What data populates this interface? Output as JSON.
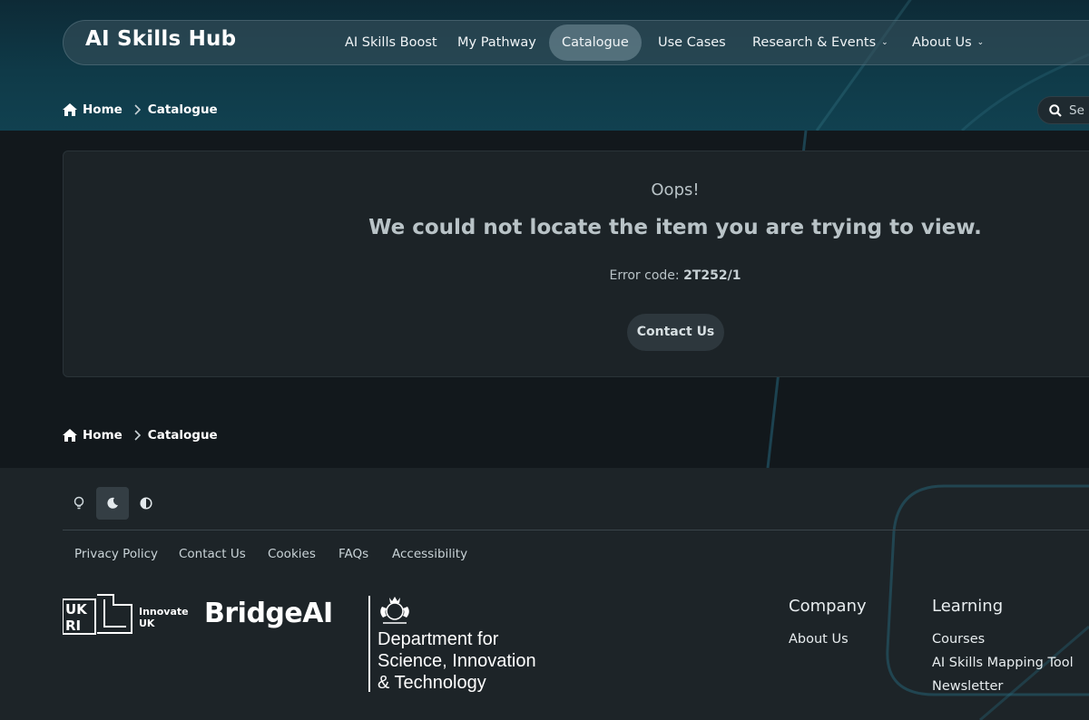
{
  "header": {
    "brand": "AI Skills Hub",
    "nav": [
      {
        "label": "AI Skills Boost"
      },
      {
        "label": "My Pathway"
      },
      {
        "label": "Catalogue"
      },
      {
        "label": "Use Cases"
      },
      {
        "label": "Research & Events"
      },
      {
        "label": "About Us"
      }
    ],
    "search_placeholder": "Se"
  },
  "breadcrumb": {
    "home": "Home",
    "current": "Catalogue"
  },
  "error": {
    "oops": "Oops!",
    "headline": "We could not locate the item you are trying to view.",
    "code_label": "Error code:",
    "code_value": "2T252/1",
    "contact_button": "Contact Us"
  },
  "footer": {
    "links": [
      "Privacy Policy",
      "Contact Us",
      "Cookies",
      "FAQs",
      "Accessibility"
    ],
    "innovate_line1": "Innovate",
    "innovate_line2": "UK",
    "bridgeai": "BridgeAI",
    "dsit_line1": "Department for",
    "dsit_line2": "Science, Innovation",
    "dsit_line3": "& Technology",
    "company_title": "Company",
    "company_links": [
      "About Us"
    ],
    "learning_title": "Learning",
    "learning_links": [
      "Courses",
      "AI Skills Mapping Tool",
      "Newsletter"
    ]
  }
}
